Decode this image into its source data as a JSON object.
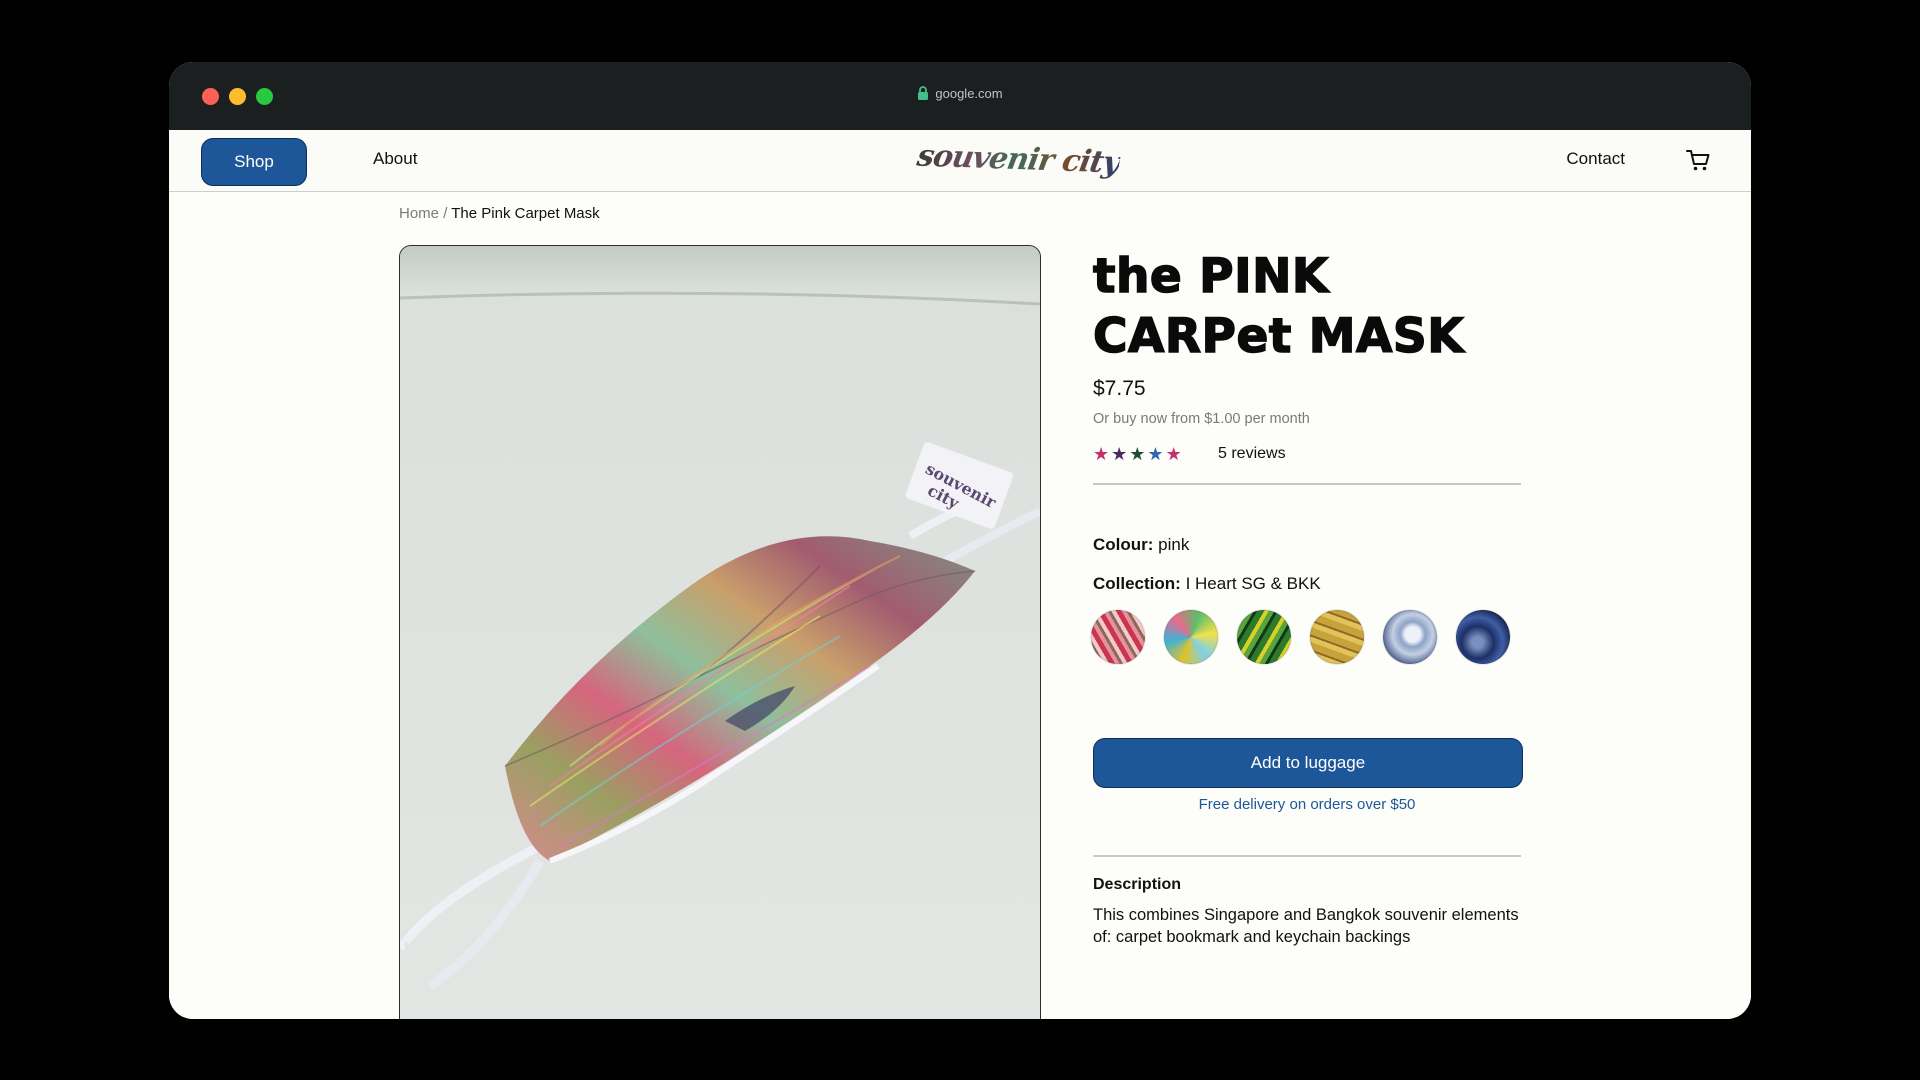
{
  "browser": {
    "url": "google.com",
    "traffic_lights": [
      "#fe5f57",
      "#febc2e",
      "#28c840"
    ]
  },
  "nav": {
    "shop": "Shop",
    "about": "About",
    "logo": "souvenir city",
    "contact": "Contact",
    "cart_icon": "cart-icon"
  },
  "breadcrumb": {
    "home": "Home",
    "separator": "/",
    "current": "The Pink Carpet Mask"
  },
  "product": {
    "title": "the PINK CARPet MASK",
    "price": "$7.75",
    "installment": "Or buy now from $1.00 per month",
    "rating": 5,
    "star_colors": [
      "#c2306d",
      "#4a2a66",
      "#1f4a36",
      "#2f67b0",
      "#c2306d"
    ],
    "reviews": "5 reviews",
    "colour_label": "Colour:",
    "colour_value": "pink",
    "collection_label": "Collection:",
    "collection_value": "I Heart SG & BKK",
    "swatch_names": [
      "pink carpet",
      "rainbow triangle",
      "green yellow",
      "gold ochre",
      "silver blue",
      "dark blue"
    ],
    "add_button": "Add to luggage",
    "delivery": "Free delivery on orders over $50",
    "description_title": "Description",
    "description": "This combines Singapore and Bangkok souvenir elements of: carpet bookmark and keychain backings"
  },
  "colors": {
    "accent": "#1e5799",
    "titlebar": "#1c1f20"
  }
}
